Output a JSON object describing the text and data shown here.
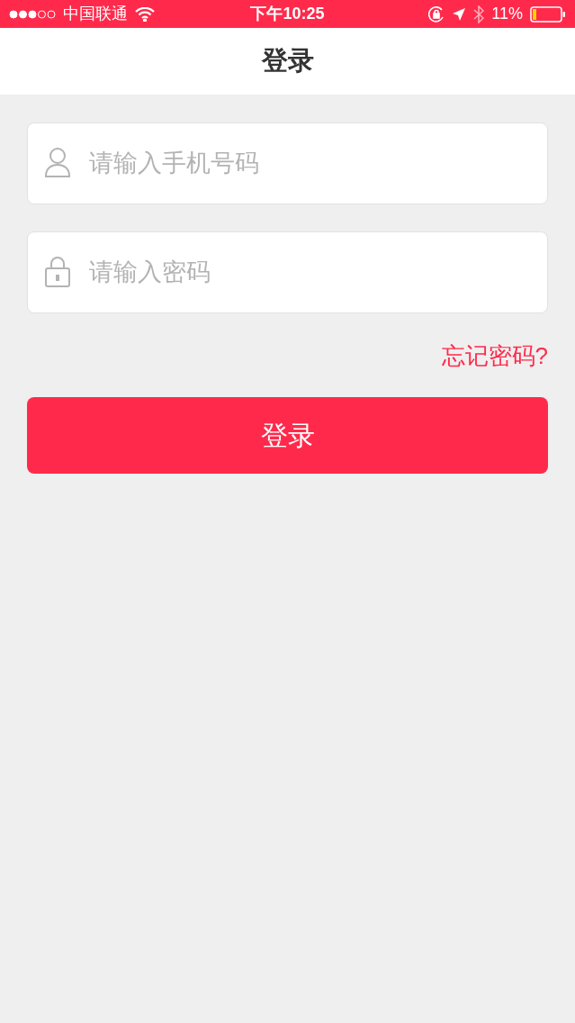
{
  "status_bar": {
    "carrier": "中国联通",
    "time": "下午10:25",
    "battery": "11%"
  },
  "nav": {
    "title": "登录"
  },
  "fields": [
    {
      "kind": "phone",
      "placeholder": "请输入手机号码"
    },
    {
      "kind": "password",
      "placeholder": "请输入密码"
    }
  ],
  "forgot_link": "忘记密码?",
  "login_button": "登录"
}
